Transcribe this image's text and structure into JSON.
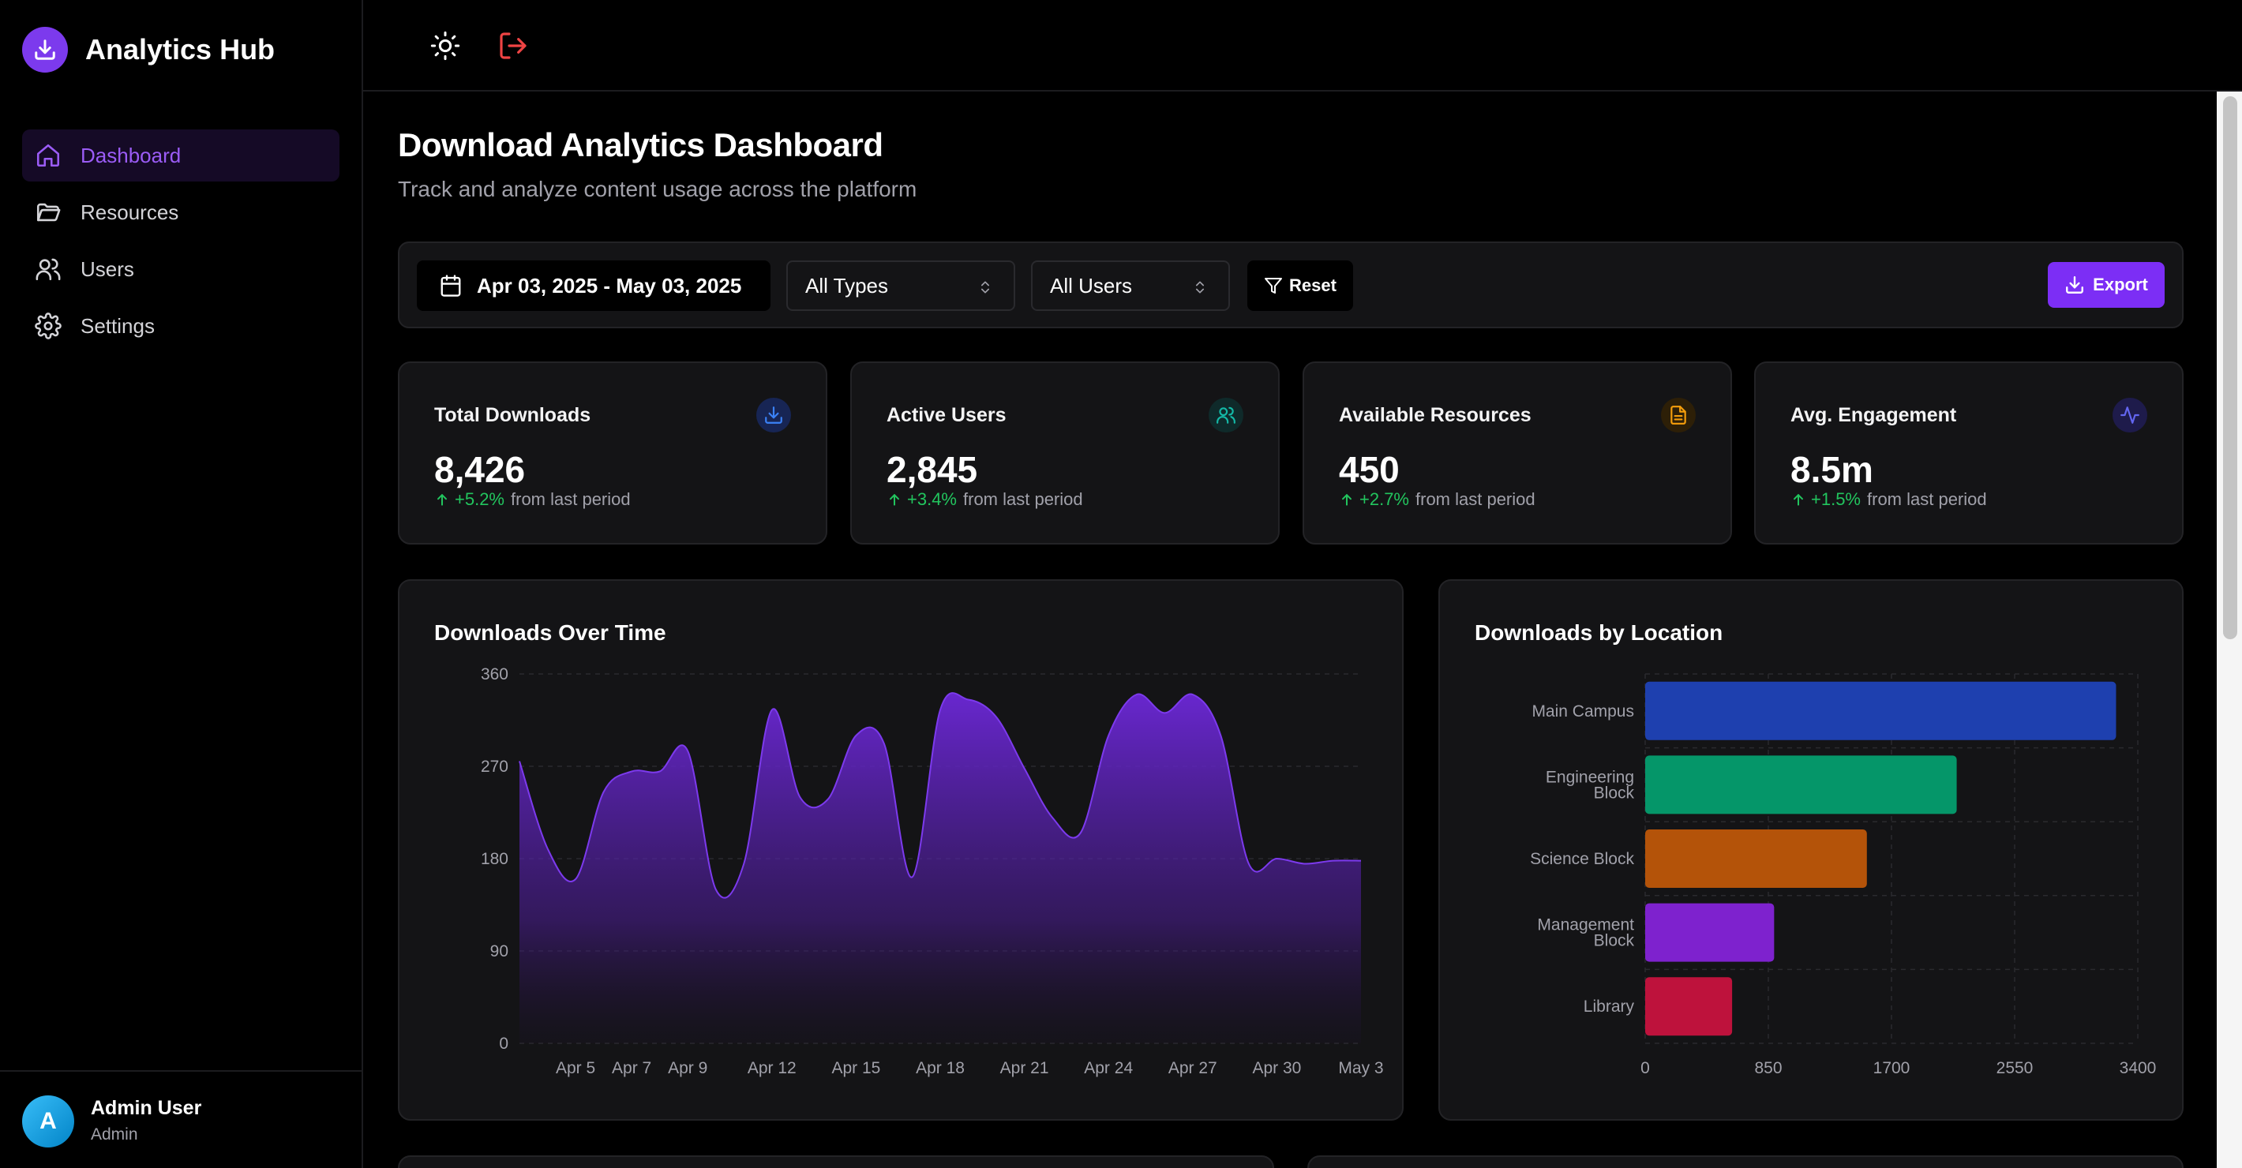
{
  "app": {
    "title": "Analytics Hub"
  },
  "sidebar": {
    "items": [
      {
        "label": "Dashboard",
        "icon": "home-icon",
        "active": true
      },
      {
        "label": "Resources",
        "icon": "folder-icon",
        "active": false
      },
      {
        "label": "Users",
        "icon": "users-icon",
        "active": false
      },
      {
        "label": "Settings",
        "icon": "gear-icon",
        "active": false
      }
    ],
    "user": {
      "initial": "A",
      "name": "Admin User",
      "role": "Admin"
    }
  },
  "topbar": {
    "icons": [
      "sun-icon",
      "logout-icon"
    ]
  },
  "page": {
    "title": "Download Analytics Dashboard",
    "subtitle": "Track and analyze content usage across the platform"
  },
  "filters": {
    "date_range": "Apr 03, 2025 - May 03, 2025",
    "type_select": "All Types",
    "user_select": "All Users",
    "reset_label": "Reset",
    "export_label": "Export"
  },
  "stats": [
    {
      "label": "Total Downloads",
      "value": "8,426",
      "change": "+5.2%",
      "suffix": "from last period",
      "icon": "download-icon",
      "color": "#3b82f6"
    },
    {
      "label": "Active Users",
      "value": "2,845",
      "change": "+3.4%",
      "suffix": "from last period",
      "icon": "users-icon",
      "color": "#14b8a6"
    },
    {
      "label": "Available Resources",
      "value": "450",
      "change": "+2.7%",
      "suffix": "from last period",
      "icon": "file-icon",
      "color": "#f59e0b"
    },
    {
      "label": "Avg. Engagement",
      "value": "8.5m",
      "change": "+1.5%",
      "suffix": "from last period",
      "icon": "activity-icon",
      "color": "#6366f1"
    }
  ],
  "charts": {
    "time_title": "Downloads Over Time",
    "location_title": "Downloads by Location"
  },
  "chart_data": [
    {
      "type": "area",
      "title": "Downloads Over Time",
      "xlabel": "",
      "ylabel": "",
      "ylim": [
        0,
        360
      ],
      "yticks": [
        0,
        90,
        180,
        270,
        360
      ],
      "x": [
        "Apr 3",
        "Apr 4",
        "Apr 5",
        "Apr 6",
        "Apr 7",
        "Apr 8",
        "Apr 9",
        "Apr 10",
        "Apr 11",
        "Apr 12",
        "Apr 13",
        "Apr 14",
        "Apr 15",
        "Apr 16",
        "Apr 17",
        "Apr 18",
        "Apr 19",
        "Apr 20",
        "Apr 21",
        "Apr 22",
        "Apr 23",
        "Apr 24",
        "Apr 25",
        "Apr 26",
        "Apr 27",
        "Apr 28",
        "Apr 29",
        "Apr 30",
        "May 1",
        "May 2",
        "May 3"
      ],
      "xtick_labels": [
        "Apr 5",
        "Apr 7",
        "Apr 9",
        "Apr 12",
        "Apr 15",
        "Apr 18",
        "Apr 21",
        "Apr 24",
        "Apr 27",
        "Apr 30",
        "May 3"
      ],
      "series": [
        {
          "values": [
            275,
            190,
            160,
            245,
            265,
            265,
            285,
            150,
            175,
            325,
            240,
            238,
            300,
            292,
            162,
            325,
            335,
            318,
            268,
            220,
            205,
            300,
            340,
            322,
            340,
            300,
            175,
            180,
            175,
            178,
            178
          ]
        }
      ],
      "color": "#6d28d9",
      "grid": true
    },
    {
      "type": "bar",
      "orientation": "horizontal",
      "title": "Downloads by Location",
      "categories": [
        "Main Campus",
        "Engineering Block",
        "Science Block",
        "Management Block",
        "Library"
      ],
      "values": [
        3250,
        2150,
        1530,
        890,
        600
      ],
      "xlim": [
        0,
        3400
      ],
      "xticks": [
        0,
        850,
        1700,
        2550,
        3400
      ],
      "colors": [
        "#1e40af",
        "#059669",
        "#b45309",
        "#7e22ce",
        "#be123c"
      ],
      "grid": true
    }
  ]
}
